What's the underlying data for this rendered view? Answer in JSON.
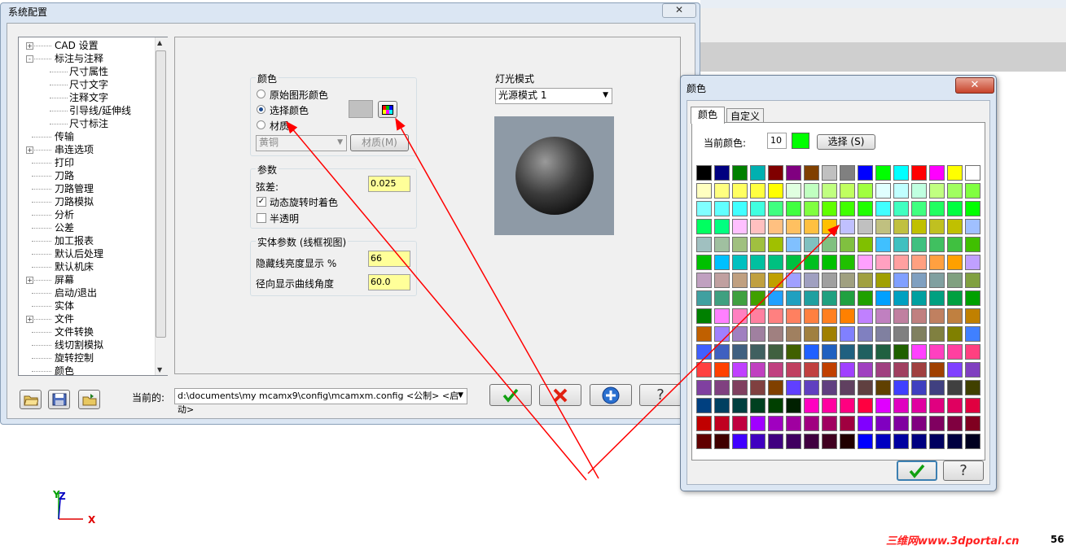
{
  "main_dialog": {
    "title": "系统配置",
    "close": "✕",
    "tree": [
      {
        "label": "CAD 设置",
        "level": 0,
        "expander": "+"
      },
      {
        "label": "标注与注释",
        "level": 0,
        "expander": "−"
      },
      {
        "label": "尺寸属性",
        "level": 1
      },
      {
        "label": "尺寸文字",
        "level": 1
      },
      {
        "label": "注释文字",
        "level": 1
      },
      {
        "label": "引导线/延伸线",
        "level": 1
      },
      {
        "label": "尺寸标注",
        "level": 1
      },
      {
        "label": "传输",
        "level": 0
      },
      {
        "label": "串连选项",
        "level": 0,
        "expander": "+"
      },
      {
        "label": "打印",
        "level": 0
      },
      {
        "label": "刀路",
        "level": 0
      },
      {
        "label": "刀路管理",
        "level": 0
      },
      {
        "label": "刀路模拟",
        "level": 0
      },
      {
        "label": "分析",
        "level": 0
      },
      {
        "label": "公差",
        "level": 0
      },
      {
        "label": "加工报表",
        "level": 0
      },
      {
        "label": "默认后处理",
        "level": 0
      },
      {
        "label": "默认机床",
        "level": 0
      },
      {
        "label": "屏幕",
        "level": 0,
        "expander": "+"
      },
      {
        "label": "启动/退出",
        "level": 0
      },
      {
        "label": "实体",
        "level": 0
      },
      {
        "label": "文件",
        "level": 0,
        "expander": "+"
      },
      {
        "label": "文件转换",
        "level": 0
      },
      {
        "label": "线切割模拟",
        "level": 0
      },
      {
        "label": "旋转控制",
        "level": 0
      },
      {
        "label": "颜色",
        "level": 0
      }
    ],
    "color_group": {
      "title": "颜色",
      "opt_original": "原始图形颜色",
      "opt_select": "选择颜色",
      "opt_material": "材质",
      "selected": "选择颜色",
      "material_combo": "黄铜",
      "material_button": "材质(M)"
    },
    "params_group": {
      "title": "参数",
      "chord_label": "弦差:",
      "chord_value": "0.025",
      "dynamic_shade_label": "动态旋转时着色",
      "dynamic_shade_checked": true,
      "translucent_label": "半透明",
      "translucent_checked": false
    },
    "solid_group": {
      "title": "实体参数 (线框视图)",
      "hidden_label": "隐藏线亮度显示 %",
      "hidden_value": "66",
      "radial_label": "径向显示曲线角度",
      "radial_value": "60.0"
    },
    "lighting": {
      "title": "灯光模式",
      "value": "光源模式 1"
    },
    "current_label": "当前的:",
    "current_path": "d:\\documents\\my mcamx9\\config\\mcamxm.config <公制> <启动>",
    "bottom_icons": [
      "open-folder-icon",
      "save-icon",
      "merge-folder-icon"
    ],
    "action_buttons": [
      "confirm-icon",
      "cancel-icon",
      "add-icon",
      "help-icon"
    ]
  },
  "color_dialog": {
    "title": "颜色",
    "close": "✕",
    "tabs": [
      "颜色",
      "自定义"
    ],
    "active_tab": "颜色",
    "current_color_label": "当前颜色:",
    "current_color_value": "10",
    "current_color_swatch": "#00ff00",
    "select_button": "选择 (S)",
    "palette_rows": [
      [
        "#000000",
        "#000080",
        "#008000",
        "#00b0b0",
        "#800000",
        "#800080",
        "#804000",
        "#c0c0c0",
        "#808080",
        "#0000ff",
        "#00ff00",
        "#00ffff",
        "#ff0000",
        "#ff00ff",
        "#ffff00",
        "#ffffff"
      ],
      [
        "#ffffc0",
        "#ffff80",
        "#ffff60",
        "#ffff40",
        "#ffff00",
        "#e0ffe0",
        "#c0ffc0",
        "#c0ff80",
        "#c0ff60",
        "#a0ff40",
        "#e0ffff",
        "#c0ffff",
        "#c0ffe0",
        "#c0ff80",
        "#a0ff60",
        "#80ff40"
      ],
      [
        "#80ffff",
        "#60ffff",
        "#40ffff",
        "#40ffe0",
        "#40ff80",
        "#40ff40",
        "#80ff40",
        "#60ff00",
        "#40ff00",
        "#20ff00",
        "#40ffff",
        "#40ffc0",
        "#40ff80",
        "#20ff60",
        "#00ff40",
        "#00ff00"
      ],
      [
        "#00ff60",
        "#00ff80",
        "#ffc0ff",
        "#ffc0c0",
        "#ffc080",
        "#ffc060",
        "#ffc040",
        "#ffc000",
        "#c0c0ff",
        "#c0c0c0",
        "#c0c080",
        "#c0c040",
        "#c0c000",
        "#c0c020",
        "#c0c000",
        "#a0c0ff"
      ],
      [
        "#a0c0c0",
        "#a0c0a0",
        "#a0c080",
        "#a0c040",
        "#a0c000",
        "#80c0ff",
        "#80c0c0",
        "#80c080",
        "#80c040",
        "#80c000",
        "#40c0ff",
        "#40c0c0",
        "#40c080",
        "#40c060",
        "#40c040",
        "#40c000"
      ],
      [
        "#00c000",
        "#00c0ff",
        "#00c0c0",
        "#00c0a0",
        "#00c080",
        "#00c040",
        "#00c020",
        "#00c000",
        "#20c000",
        "#ffa0ff",
        "#ffa0c0",
        "#ffa0a0",
        "#ffa080",
        "#ffa040",
        "#ffa000",
        "#c0a0ff"
      ],
      [
        "#c0a0c0",
        "#c0a0a0",
        "#c0a080",
        "#c0a040",
        "#c0a000",
        "#a0a0ff",
        "#a0a0c0",
        "#a0a0a0",
        "#a0a080",
        "#a0a040",
        "#a0a000",
        "#80a0ff",
        "#80a0c0",
        "#80a0a0",
        "#80a080",
        "#80a040"
      ],
      [
        "#40a0a0",
        "#40a080",
        "#40a040",
        "#40a000",
        "#20a0ff",
        "#20a0c0",
        "#20a0a0",
        "#20a080",
        "#20a040",
        "#20a000",
        "#00a0ff",
        "#00a0c0",
        "#00a0a0",
        "#00a080",
        "#00a040",
        "#00a000"
      ],
      [
        "#008000",
        "#ff80ff",
        "#ff80c0",
        "#ff80a0",
        "#ff8080",
        "#ff8060",
        "#ff8040",
        "#ff8020",
        "#ff8000",
        "#c080ff",
        "#c080c0",
        "#c080a0",
        "#c08080",
        "#c08060",
        "#c08040",
        "#c08000"
      ],
      [
        "#c06000",
        "#a080ff",
        "#a080c0",
        "#a080a0",
        "#a08080",
        "#a08060",
        "#a08040",
        "#a08000",
        "#8080ff",
        "#8080c0",
        "#8080a0",
        "#808080",
        "#808060",
        "#808040",
        "#808000",
        "#4080ff"
      ],
      [
        "#4060ff",
        "#4060c0",
        "#406080",
        "#406060",
        "#406040",
        "#406000",
        "#2060ff",
        "#2060c0",
        "#206080",
        "#206060",
        "#206040",
        "#206000",
        "#ff40ff",
        "#ff40c0",
        "#ff40a0",
        "#ff4080"
      ],
      [
        "#ff4040",
        "#ff4000",
        "#c040ff",
        "#c040c0",
        "#c04080",
        "#c04060",
        "#c04040",
        "#c04000",
        "#a040ff",
        "#a040c0",
        "#a04080",
        "#a04060",
        "#a04040",
        "#a04000",
        "#8040ff",
        "#8040c0"
      ],
      [
        "#8040a0",
        "#804080",
        "#804060",
        "#804040",
        "#804000",
        "#6040ff",
        "#6040c0",
        "#604080",
        "#604060",
        "#604040",
        "#604000",
        "#4040ff",
        "#4040c0",
        "#404080",
        "#404040",
        "#404000"
      ],
      [
        "#004080",
        "#004060",
        "#004040",
        "#004020",
        "#004000",
        "#002000",
        "#ff00c0",
        "#ff00a0",
        "#ff0080",
        "#ff0040",
        "#e000ff",
        "#e000c0",
        "#e000a0",
        "#e00080",
        "#e00060",
        "#e00040"
      ],
      [
        "#c00000",
        "#c00020",
        "#c00040",
        "#a000ff",
        "#a000c0",
        "#a000a0",
        "#a00080",
        "#a00060",
        "#a00040",
        "#8000ff",
        "#8000c0",
        "#8000a0",
        "#800080",
        "#800060",
        "#800040",
        "#800020"
      ],
      [
        "#600000",
        "#400000",
        "#4000ff",
        "#4000c0",
        "#400080",
        "#400060",
        "#400040",
        "#400020",
        "#200000",
        "#0000ff",
        "#0000c0",
        "#0000a0",
        "#000080",
        "#000060",
        "#000040",
        "#000020"
      ]
    ],
    "ok_icon": "confirm-icon",
    "help_icon": "help-icon"
  },
  "viewport": {
    "axis_z": "Z",
    "axis_y": "Y",
    "axis_x": "X",
    "watermark": "三维网www.3dportal.cn",
    "corner_number": "56"
  },
  "colors": {
    "field_yellow": "#ffff99",
    "arrow_red": "#ff0000",
    "dialog_blue": "#dbe6f3"
  }
}
